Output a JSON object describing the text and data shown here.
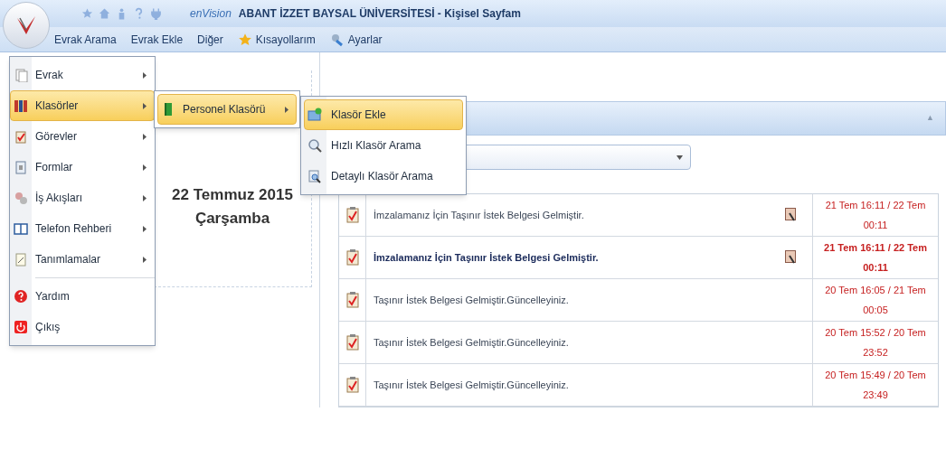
{
  "window": {
    "logo": "enVision",
    "title": "ABANT İZZET BAYSAL ÜNİVERSİTESİ - Kişisel Sayfam"
  },
  "menu_bar": [
    "Evrak Arama",
    "Evrak Ekle",
    "Diğer",
    "Kısayollarım",
    "Ayarlar"
  ],
  "main_menu": [
    {
      "label": "Evrak",
      "submenu": true,
      "selected": false
    },
    {
      "label": "Klasörler",
      "submenu": true,
      "selected": true
    },
    {
      "label": "Görevler",
      "submenu": true,
      "selected": false
    },
    {
      "label": "Formlar",
      "submenu": true,
      "selected": false
    },
    {
      "label": "İş Akışları",
      "submenu": true,
      "selected": false
    },
    {
      "label": "Telefon Rehberi",
      "submenu": true,
      "selected": false
    },
    {
      "label": "Tanımlamalar",
      "submenu": true,
      "selected": false
    },
    {
      "label": "Yardım",
      "submenu": false,
      "selected": false
    },
    {
      "label": "Çıkış",
      "submenu": false,
      "selected": false
    }
  ],
  "submenu": [
    {
      "label": "Personel Klasörü",
      "submenu": true,
      "selected": true
    }
  ],
  "submenu_2": [
    {
      "label": "Klasör Ekle",
      "selected": true
    },
    {
      "label": "Hızlı Klasör Arama",
      "selected": false
    },
    {
      "label": "Detaylı Klasör Arama",
      "selected": false
    }
  ],
  "date_card": {
    "date": "22 Temmuz 2015",
    "weekday": "Çarşamba"
  },
  "panel": {
    "collapse": "▲"
  },
  "tasks": [
    {
      "text": "İmzalamanız İçin Taşınır İstek Belgesi Gelmiştir.",
      "bold": false,
      "preview": true,
      "date": "21 Tem 16:11 / 22 Tem 00:11"
    },
    {
      "text": "İmzalamanız İçin Taşınır İstek Belgesi Gelmiştir.",
      "bold": true,
      "preview": true,
      "date": "21 Tem 16:11 / 22 Tem 00:11"
    },
    {
      "text": "Taşınır İstek Belgesi Gelmiştir.Güncelleyiniz.",
      "bold": false,
      "preview": false,
      "date": "20 Tem 16:05 / 21 Tem 00:05"
    },
    {
      "text": "Taşınır İstek Belgesi Gelmiştir.Güncelleyiniz.",
      "bold": false,
      "preview": false,
      "date": "20 Tem 15:52 / 20 Tem 23:52"
    },
    {
      "text": "Taşınır İstek Belgesi Gelmiştir.Güncelleyiniz.",
      "bold": false,
      "preview": false,
      "date": "20 Tem 15:49 / 20 Tem 23:49"
    }
  ]
}
